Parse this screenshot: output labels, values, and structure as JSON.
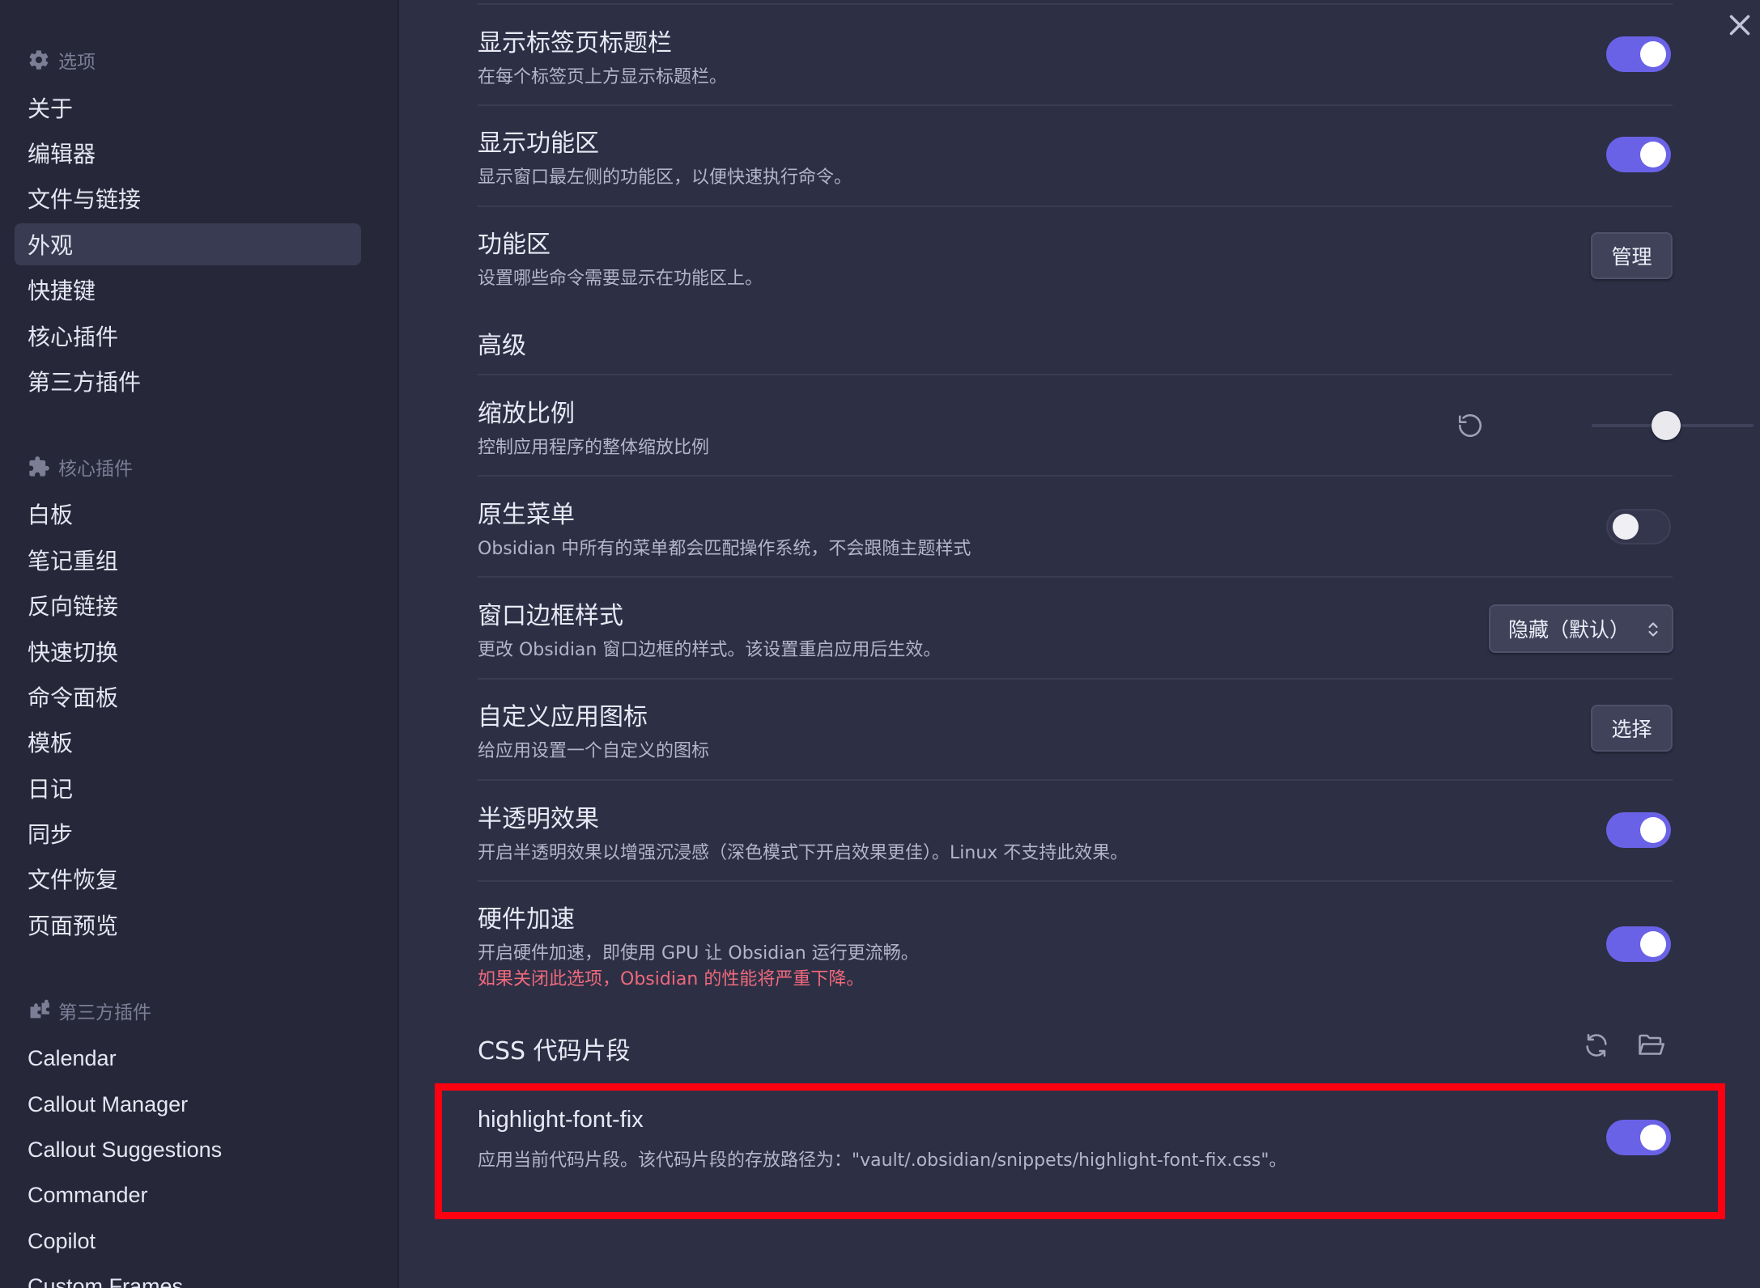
{
  "sidebar": {
    "options_group": {
      "title": "选项",
      "icon": "gear-icon",
      "items": [
        {
          "label": "关于"
        },
        {
          "label": "编辑器"
        },
        {
          "label": "文件与链接"
        },
        {
          "label": "外观",
          "active": true
        },
        {
          "label": "快捷键"
        },
        {
          "label": "核心插件"
        },
        {
          "label": "第三方插件"
        }
      ]
    },
    "core_plugins_group": {
      "title": "核心插件",
      "icon": "puzzle-icon",
      "items": [
        {
          "label": "白板"
        },
        {
          "label": "笔记重组"
        },
        {
          "label": "反向链接"
        },
        {
          "label": "快速切换"
        },
        {
          "label": "命令面板"
        },
        {
          "label": "模板"
        },
        {
          "label": "日记"
        },
        {
          "label": "同步"
        },
        {
          "label": "文件恢复"
        },
        {
          "label": "页面预览"
        }
      ]
    },
    "community_plugins_group": {
      "title": "第三方插件",
      "icon": "puzzle-pieces-icon",
      "items": [
        {
          "label": "Calendar"
        },
        {
          "label": "Callout Manager"
        },
        {
          "label": "Callout Suggestions"
        },
        {
          "label": "Commander"
        },
        {
          "label": "Copilot"
        },
        {
          "label": "Custom Frames"
        }
      ]
    }
  },
  "settings": {
    "show_tab_title_bar": {
      "title": "显示标签页标题栏",
      "desc": "在每个标签页上方显示标题栏。",
      "enabled": true
    },
    "show_ribbon": {
      "title": "显示功能区",
      "desc": "显示窗口最左侧的功能区，以便快速执行命令。",
      "enabled": true
    },
    "ribbon": {
      "title": "功能区",
      "desc": "设置哪些命令需要显示在功能区上。",
      "button_label": "管理"
    },
    "advanced_heading": "高级",
    "zoom": {
      "title": "缩放比例",
      "desc": "控制应用程序的整体缩放比例",
      "reset_icon": "reset-icon",
      "value_fraction": 0.46
    },
    "native_menus": {
      "title": "原生菜单",
      "desc": "Obsidian 中所有的菜单都会匹配操作系统，不会跟随主题样式",
      "enabled": false
    },
    "frame_style": {
      "title": "窗口边框样式",
      "desc": "更改 Obsidian 窗口边框的样式。该设置重启应用后生效。",
      "selected": "隐藏（默认）"
    },
    "custom_icon": {
      "title": "自定义应用图标",
      "desc": "给应用设置一个自定义的图标",
      "button_label": "选择"
    },
    "translucent": {
      "title": "半透明效果",
      "desc": "开启半透明效果以增强沉浸感（深色模式下开启效果更佳）。Linux 不支持此效果。",
      "enabled": true
    },
    "hardware_accel": {
      "title": "硬件加速",
      "desc": "开启硬件加速，即使用 GPU 让 Obsidian 运行更流畅。",
      "warning": "如果关闭此选项，Obsidian 的性能将严重下降。",
      "enabled": true
    },
    "css_snippets": {
      "title": "CSS 代码片段",
      "reload_icon": "reload-icon",
      "folder_icon": "folder-open-icon"
    },
    "snippet": {
      "title": "highlight-font-fix",
      "desc": "应用当前代码片段。该代码片段的存放路径为：\"vault/.obsidian/snippets/highlight-font-fix.css\"。",
      "enabled": true
    }
  },
  "colors": {
    "accent": "#6a62e6",
    "highlight": "#ff0010",
    "warning": "#ef6a7b"
  },
  "close_icon": "close-icon"
}
